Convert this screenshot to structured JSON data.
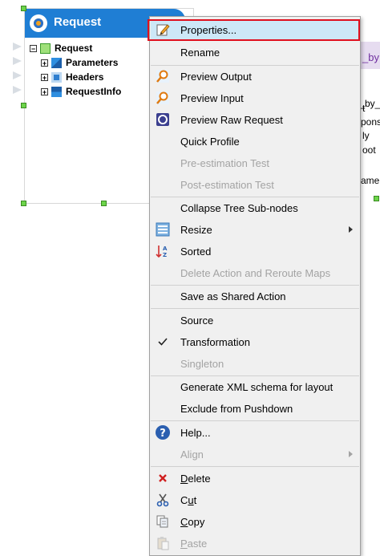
{
  "node": {
    "title": "Request",
    "tree": [
      {
        "label": "Request",
        "toggle": "−",
        "level": 0
      },
      {
        "label": "Parameters",
        "toggle": "+",
        "level": 1
      },
      {
        "label": "Headers",
        "toggle": "+",
        "level": 1
      },
      {
        "label": "RequestInfo",
        "toggle": "+",
        "level": 1
      }
    ]
  },
  "background_fragments": [
    "_by",
    "t_by_",
    "t",
    "pons",
    "ly",
    "oot",
    "ame"
  ],
  "menu": {
    "items": [
      {
        "label": "Properties...",
        "icon": "pencil-edit-icon",
        "state": "highlighted"
      },
      {
        "label": "Rename"
      },
      {
        "separator": true
      },
      {
        "label": "Preview Output",
        "icon": "magnifier-icon"
      },
      {
        "label": "Preview Input",
        "icon": "magnifier-icon"
      },
      {
        "label": "Preview Raw Request",
        "icon": "raw-request-icon"
      },
      {
        "label": "Quick Profile"
      },
      {
        "label": "Pre-estimation Test",
        "disabled": true
      },
      {
        "label": "Post-estimation Test",
        "disabled": true
      },
      {
        "separator": true
      },
      {
        "label": "Collapse Tree Sub-nodes"
      },
      {
        "label": "Resize",
        "icon": "resize-icon",
        "submenu": true
      },
      {
        "label": "Sorted",
        "icon": "sort-az-icon"
      },
      {
        "label": "Delete Action and Reroute Maps",
        "disabled": true
      },
      {
        "separator": true
      },
      {
        "label": "Save as Shared Action"
      },
      {
        "separator": true
      },
      {
        "label": "Source"
      },
      {
        "label": "Transformation",
        "checked": true
      },
      {
        "label": "Singleton",
        "disabled": true
      },
      {
        "separator": true
      },
      {
        "label": "Generate XML schema for layout"
      },
      {
        "label": "Exclude from Pushdown"
      },
      {
        "separator": true
      },
      {
        "label": "Help...",
        "icon": "help-icon"
      },
      {
        "label": "Align",
        "disabled": true,
        "submenu": true
      },
      {
        "separator": true
      },
      {
        "label": "Delete",
        "icon": "delete-x-icon",
        "mnemonic": "D"
      },
      {
        "label": "Cut",
        "icon": "scissors-icon",
        "mnemonic": "u"
      },
      {
        "label": "Copy",
        "icon": "copy-icon",
        "mnemonic": "C"
      },
      {
        "label": "Paste",
        "icon": "paste-icon",
        "mnemonic": "P",
        "disabled": true
      }
    ]
  },
  "colors": {
    "header_blue": "#1f7ed4",
    "highlight": "#cde8f7",
    "highlight_outline": "#e0101e",
    "disabled_text": "#a3a3a3",
    "handle_green": "#6cd44a",
    "fragment_purple": "#7030a0"
  }
}
